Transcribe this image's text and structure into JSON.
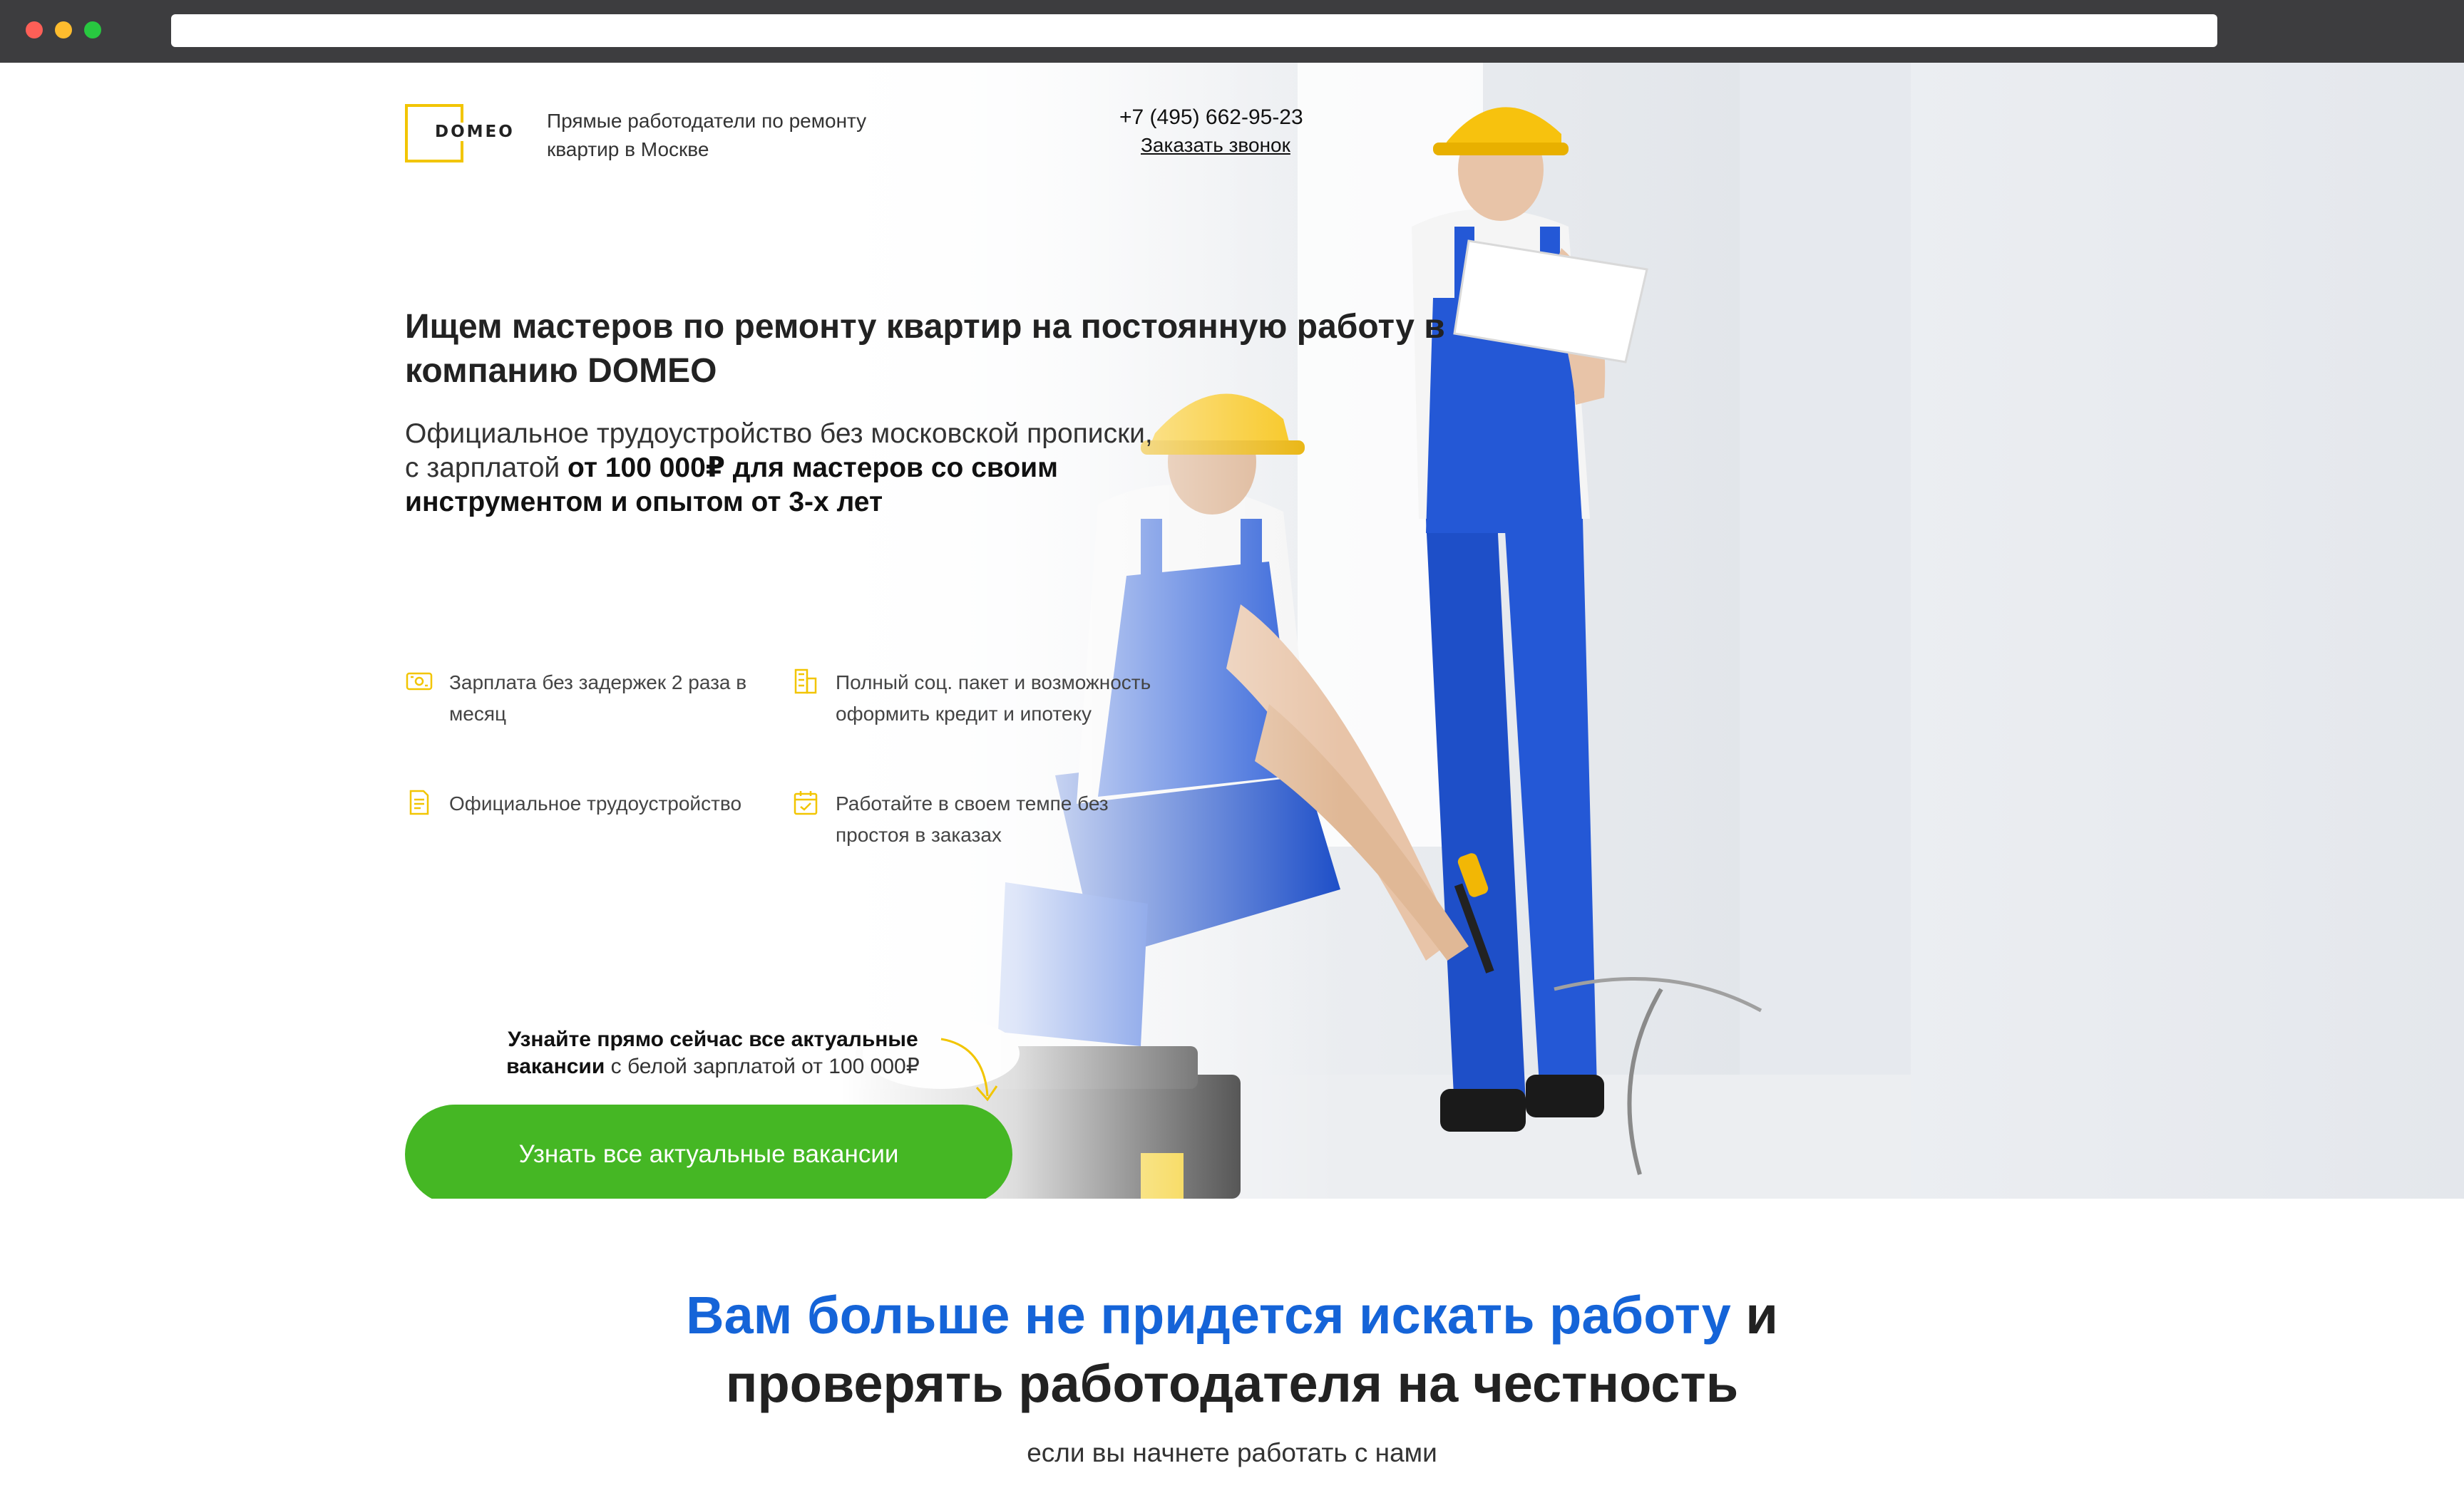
{
  "header": {
    "logo_text": "DOMEO",
    "tagline_line1": "Прямые работодатели по ремонту",
    "tagline_line2": "квартир в Москве",
    "phone": "+7 (495) 662-95-23",
    "callback_label": "Заказать звонок"
  },
  "hero": {
    "headline_line1": "Ищем мастеров по ремонту квартир на постоянную работу в",
    "headline_line2": "компанию DOMEO",
    "subline_plain": "Официальное трудоустройство без московской прописки, с зарплатой ",
    "subline_bold": "от 100 000₽ для мастеров со своим инструментом и опытом от 3-х лет",
    "features": [
      {
        "icon": "wallet-icon",
        "text": "Зарплата без задержек 2 раза в месяц"
      },
      {
        "icon": "building-icon",
        "text": "Полный соц. пакет и возможность оформить кредит и ипотеку"
      },
      {
        "icon": "document-icon",
        "text": "Официальное трудоустройство"
      },
      {
        "icon": "calendar-icon",
        "text": "Работайте в своем темпе без простоя в заказах"
      }
    ],
    "cta_note_bold_1": "Узнайте прямо сейчас все актуальные",
    "cta_note_bold_2": "вакансии",
    "cta_note_plain": " с белой зарплатой от 100 000₽",
    "cta_button": "Узнать все актуальные вакансии"
  },
  "section2": {
    "title_blue": "Вам больше не придется искать работу",
    "title_rest_1": " и",
    "title_rest_2": "проверять работодателя на честность",
    "subtitle": "если вы начнете работать с нами"
  },
  "colors": {
    "accent_yellow": "#f2c500",
    "cta_green": "#45b724",
    "title_blue": "#1564d8"
  }
}
